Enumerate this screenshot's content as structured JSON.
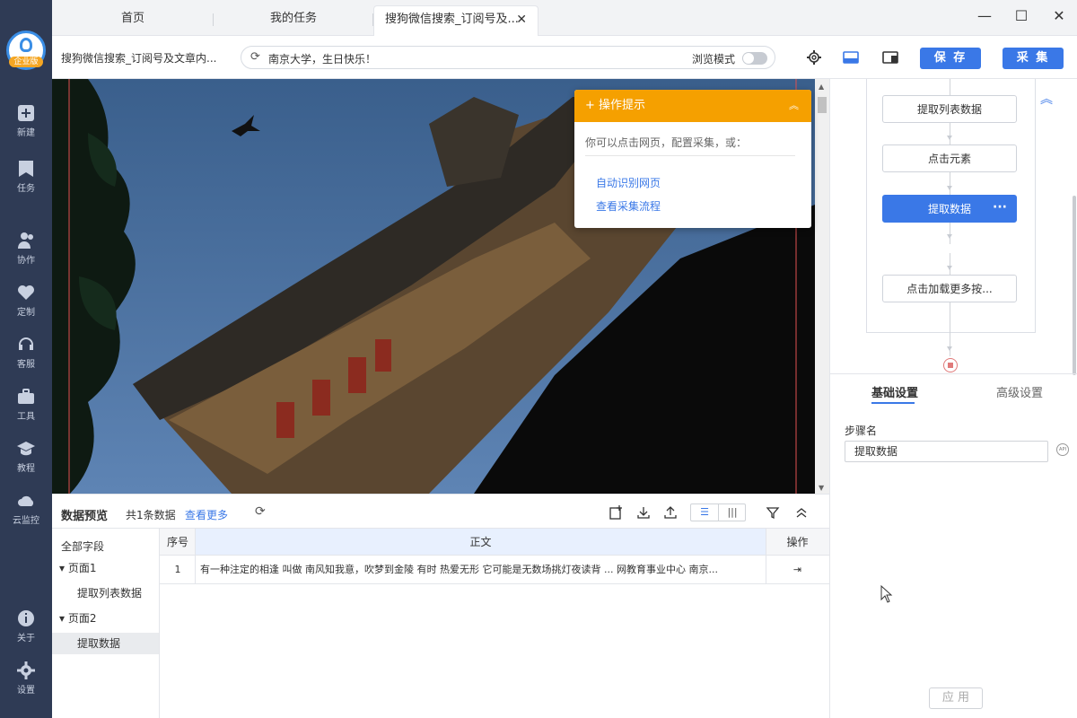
{
  "sidebar": {
    "logo_badge": "企业版",
    "items": [
      {
        "label": "新建",
        "icon": "plus-square-icon"
      },
      {
        "label": "任务",
        "icon": "bookmark-icon"
      },
      {
        "label": "协作",
        "icon": "users-icon"
      },
      {
        "label": "定制",
        "icon": "heart-icon"
      },
      {
        "label": "客服",
        "icon": "headset-icon"
      },
      {
        "label": "工具",
        "icon": "toolbox-icon"
      },
      {
        "label": "教程",
        "icon": "graduation-cap-icon"
      },
      {
        "label": "云监控",
        "icon": "cloud-monitor-icon"
      },
      {
        "label": "关于",
        "icon": "info-icon"
      },
      {
        "label": "设置",
        "icon": "gear-icon"
      }
    ]
  },
  "tabs": [
    {
      "label": "首页"
    },
    {
      "label": "我的任务"
    },
    {
      "label": "搜狗微信搜索_订阅号及..."
    }
  ],
  "toolbar": {
    "page_name": "搜狗微信搜索_订阅号及文章内...",
    "url": "南京大学，生日快乐！",
    "mode_label": "浏览模式",
    "save_label": "保 存",
    "collect_label": "采 集"
  },
  "hint": {
    "title": "操作提示",
    "desc": "你可以点击网页，配置采集，或：",
    "links": [
      "自动识别网页",
      "查看采集流程"
    ]
  },
  "workflow": {
    "steps": [
      "提取列表数据",
      "点击元素",
      "提取数据",
      "点击加载更多按..."
    ]
  },
  "settings": {
    "tabs": [
      "基础设置",
      "高级设置"
    ],
    "step_name_label": "步骤名",
    "step_name_value": "提取数据",
    "api_label": "API",
    "apply_label": "应 用"
  },
  "preview": {
    "title": "数据预览",
    "count": "共1条数据",
    "more": "查看更多",
    "tree": [
      "全部字段",
      "页面1",
      "提取列表数据",
      "页面2",
      "提取数据"
    ],
    "columns": [
      "序号",
      "正文",
      "操作"
    ],
    "rows": [
      {
        "index": "1",
        "text": "有一种注定的相逢 叫做 南风知我意，吹梦到金陵 有时 热爱无形 它可能是无数场挑灯夜读背 ... 网教育事业中心 南京..."
      }
    ]
  },
  "colors": {
    "sidebar_bg": "#2f3b55",
    "primary": "#3a78e7",
    "hint_header": "#f5a000"
  }
}
